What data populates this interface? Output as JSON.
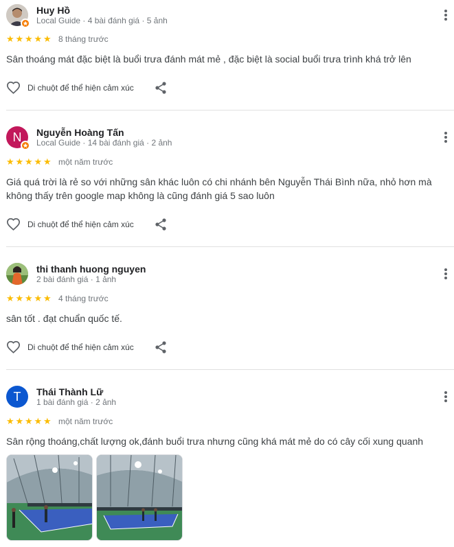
{
  "reviews": [
    {
      "name": "Huy Hồ",
      "meta": "Local Guide · 4 bài đánh giá · 5 ảnh",
      "rating": 5,
      "date": "8 tháng trước",
      "text": "Sân thoáng mát đặc biệt là buổi trưa đánh mát mẻ , đặc biệt là social buổi trưa trình khá trở lên",
      "react_label": "Di chuột để thể hiện cảm xúc",
      "avatar": {
        "type": "photo",
        "color": "#8a7565"
      }
    },
    {
      "name": "Nguyễn Hoàng Tấn",
      "meta": "Local Guide · 14 bài đánh giá · 2 ảnh",
      "rating": 5,
      "date": "một năm trước",
      "text": "Giá quá trời là rẻ so với những sân khác luôn có chi nhánh bên Nguyễn Thái Bình nữa, nhỏ hơn mà không thấy trên google map không là cũng đánh giá 5 sao luôn",
      "react_label": "Di chuột để thể hiện cảm xúc",
      "avatar": {
        "type": "letter",
        "letter": "N",
        "color": "#c2185b"
      }
    },
    {
      "name": "thi thanh huong nguyen",
      "meta": "2 bài đánh giá · 1 ảnh",
      "rating": 5,
      "date": "4 tháng trước",
      "text": "sân tốt . đạt chuẩn quốc tế.",
      "react_label": "Di chuột để thể hiện cảm xúc",
      "avatar": {
        "type": "photo",
        "color": "#d98a3a"
      }
    },
    {
      "name": "Thái Thành Lữ",
      "meta": "1 bài đánh giá · 2 ảnh",
      "rating": 5,
      "date": "một năm trước",
      "text": "Sân rộng thoáng,chất lượng ok,đánh buổi trưa nhưng cũng khá mát mẻ do có cây cối xung quanh",
      "avatar": {
        "type": "letter",
        "letter": "T",
        "color": "#0b57d0"
      },
      "photos": [
        "court-photo",
        "court-photo"
      ]
    }
  ],
  "colors": {
    "star": "#fbbc04",
    "badge": "#f57c00",
    "court_blue": "#3a5fbf",
    "court_green": "#3f8a56"
  }
}
